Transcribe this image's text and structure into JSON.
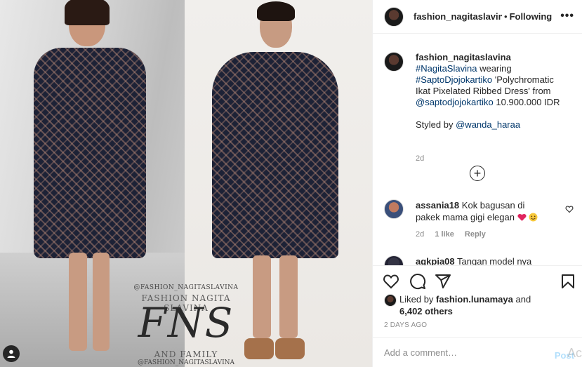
{
  "post": {
    "image": {
      "watermark_handle_top": "@FASHION_NAGITASLAVINA",
      "watermark_title": "FASHION NAGITA SLAVINA",
      "watermark_logo": "FNS",
      "watermark_subtitle": "AND FAMILY",
      "watermark_handle_bottom": "@FASHION_NAGITASLAVINA"
    },
    "header": {
      "username": "fashion_nagitaslavina",
      "separator": "•",
      "follow_state": "Following",
      "more_glyph": "•••"
    },
    "caption": {
      "username": "fashion_nagitaslavina",
      "hashtag1": "#NagitaSlavina",
      "text1": "wearing",
      "hashtag2": "#SaptoDjojokartiko",
      "text2": "'Polychromatic Ikat Pixelated Ribbed Dress' from",
      "mention1": "@saptodjojokartiko",
      "text3": "10.900.000 IDR",
      "styled_prefix": "Styled by",
      "mention2": "@wanda_haraa",
      "time": "2d"
    },
    "load_more_glyph": "+",
    "comments": [
      {
        "username": "assania18",
        "text": "Kok bagusan di pakek mama gigi elegan",
        "time": "2d",
        "likes": "1 like",
        "reply": "Reply"
      },
      {
        "username": "agkpia08",
        "text": "Tangan model nya"
      }
    ],
    "actions": {
      "like": "heart-icon",
      "comment": "comment-icon",
      "share": "share-icon",
      "save": "bookmark-icon"
    },
    "likes": {
      "prefix": "Liked by",
      "user": "fashion.lunamaya",
      "and": "and",
      "others": "6,402 others"
    },
    "date": "2 DAYS AGO",
    "add_comment": {
      "placeholder": "Add a comment…",
      "post_label": "Post"
    },
    "os_watermark": "Act"
  },
  "colors": {
    "link": "#00376b",
    "meta": "#8e8e8e",
    "text": "#262626",
    "post_disabled": "#b2dffc",
    "heart_red": "#e0245e"
  }
}
